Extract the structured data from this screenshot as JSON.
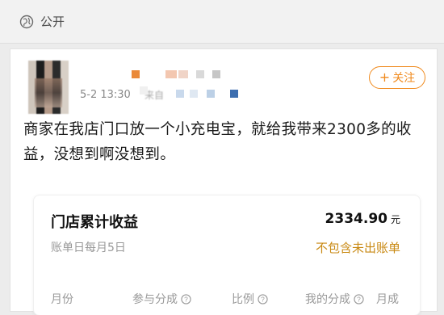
{
  "visibility": {
    "icon": "globe-icon",
    "label": "公开"
  },
  "post": {
    "avatar": "avatar",
    "meta": {
      "time": "5-2 13:30",
      "source": "来自"
    },
    "follow_label": "关注",
    "text": "商家在我店门口放一个小充电宝，就给我带来2300多的收益，没想到啊没想到。"
  },
  "earnings": {
    "title": "门店累计收益",
    "amount": "2334.90",
    "unit": "元",
    "billing_day": "账单日每月5日",
    "note": "不包含未出账单",
    "columns": [
      "月份",
      "参与分成",
      "比例",
      "我的分成",
      "月成"
    ]
  },
  "colors": {
    "accent": "#f08a1d",
    "note": "#c98a14"
  }
}
